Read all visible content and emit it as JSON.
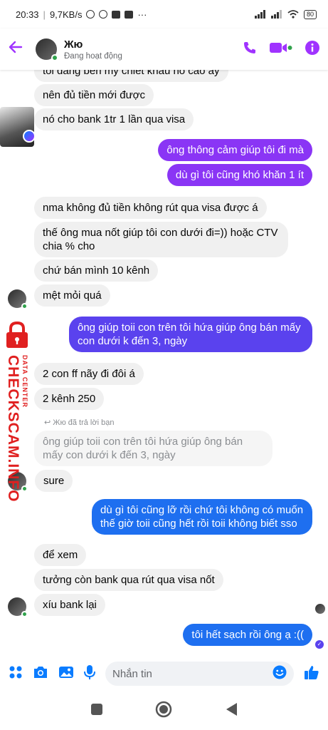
{
  "status_bar": {
    "time": "20:33",
    "speed": "9,7KB/s",
    "battery": "80",
    "more": "···"
  },
  "header": {
    "contact_name": "Жю",
    "status": "Đang hoạt động"
  },
  "colors": {
    "accent": "#a033ff",
    "outgoing_purple": "#8a35f5",
    "outgoing_indigo": "#5a42ee",
    "outgoing_blue": "#1e6ff0",
    "incoming": "#f0f0f0",
    "online": "#31a24c"
  },
  "messages": [
    {
      "dir": "in",
      "text": "tôi đang bên my chiết khấu nó cao ấy"
    },
    {
      "dir": "in",
      "text": "nên đủ tiền mới được"
    },
    {
      "dir": "in",
      "text": "nó cho bank 1tr 1 lần qua visa"
    },
    {
      "dir": "out",
      "text": "ông thông cảm giúp tôi đi mà"
    },
    {
      "dir": "out",
      "text": "dù gì tôi cũng khó khăn 1 ít"
    },
    {
      "dir": "in",
      "text": "nma không đủ tiền không rút qua visa được á"
    },
    {
      "dir": "in",
      "text": "thế ông mua nốt giúp tôi con dưới đi=)) hoặc CTV chia % cho"
    },
    {
      "dir": "in",
      "text": "chứ bán mình 10 kênh"
    },
    {
      "dir": "in",
      "text": "mệt mỏi quá"
    },
    {
      "dir": "out",
      "text": "ông giúp toii con trên tôi hứa giúp ông bán mấy con dưới k đến 3, ngày"
    },
    {
      "dir": "in",
      "text": "2 con ff nãy đi đôi á"
    },
    {
      "dir": "in",
      "text": "2 kênh 250"
    },
    {
      "dir": "in",
      "text": "sure",
      "reply_label": "Жю đã trả lời bạn",
      "quoted": "ông giúp toii con trên tôi hứa giúp ông bán mấy con dưới k đến 3, ngày"
    },
    {
      "dir": "out",
      "text": "dù gì tôi cũng lỡ rồi chứ tôi không có muốn thế giờ toii cũng hết rồi toii không biết sso"
    },
    {
      "dir": "in",
      "text": "để xem"
    },
    {
      "dir": "in",
      "text": "tưởng còn bank qua rút qua visa nốt"
    },
    {
      "dir": "in",
      "text": "xíu bank lại"
    },
    {
      "dir": "out",
      "text": "tôi hết sạch rồi ông ạ :(("
    }
  ],
  "composer": {
    "placeholder": "Nhắn tin"
  },
  "watermark": {
    "main": "CHECKSCAM.INFO",
    "sub": "DATA CENTER"
  },
  "icons": [
    "back-arrow-icon",
    "phone-icon",
    "video-icon",
    "info-icon",
    "apps-icon",
    "camera-icon",
    "gallery-icon",
    "mic-icon",
    "emoji-icon",
    "like-icon",
    "messenger-icon",
    "lock-icon"
  ]
}
